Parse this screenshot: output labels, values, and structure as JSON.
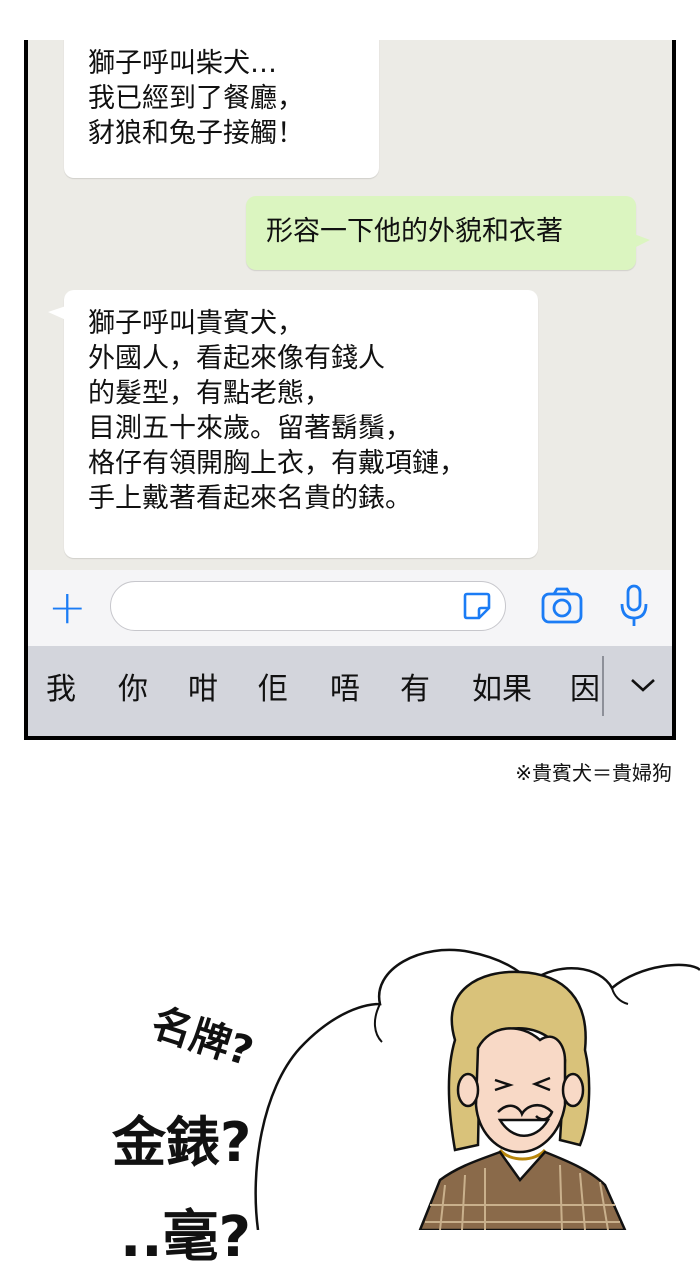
{
  "chat": {
    "messages": [
      {
        "from": "incoming",
        "text": "獅子呼叫柴犬…\n我已經到了餐廳，\n豺狼和兔子接觸！"
      },
      {
        "from": "outgoing",
        "text": "形容一下他的外貌和衣著"
      },
      {
        "from": "incoming",
        "text": "獅子呼叫貴賓犬，\n外國人，看起來像有錢人\n的髮型，有點老態，\n目測五十來歲。留著鬍鬚，\n格仔有領開胸上衣，有戴項鏈，\n手上戴著看起來名貴的錶。"
      }
    ]
  },
  "input_bar": {
    "placeholder": "",
    "icons": [
      "plus-icon",
      "sticker-icon",
      "camera-icon",
      "microphone-icon"
    ],
    "accent_color": "#1b7cf5"
  },
  "keyboard": {
    "candidates": [
      "我",
      "你",
      "咁",
      "佢",
      "唔",
      "有",
      "如果",
      "因"
    ],
    "expand_icon": "chevron-down-icon"
  },
  "footnote": "※貴賓犬＝貴婦狗",
  "comic": {
    "words": [
      "名牌?",
      "金錶?",
      "..毫?"
    ]
  }
}
